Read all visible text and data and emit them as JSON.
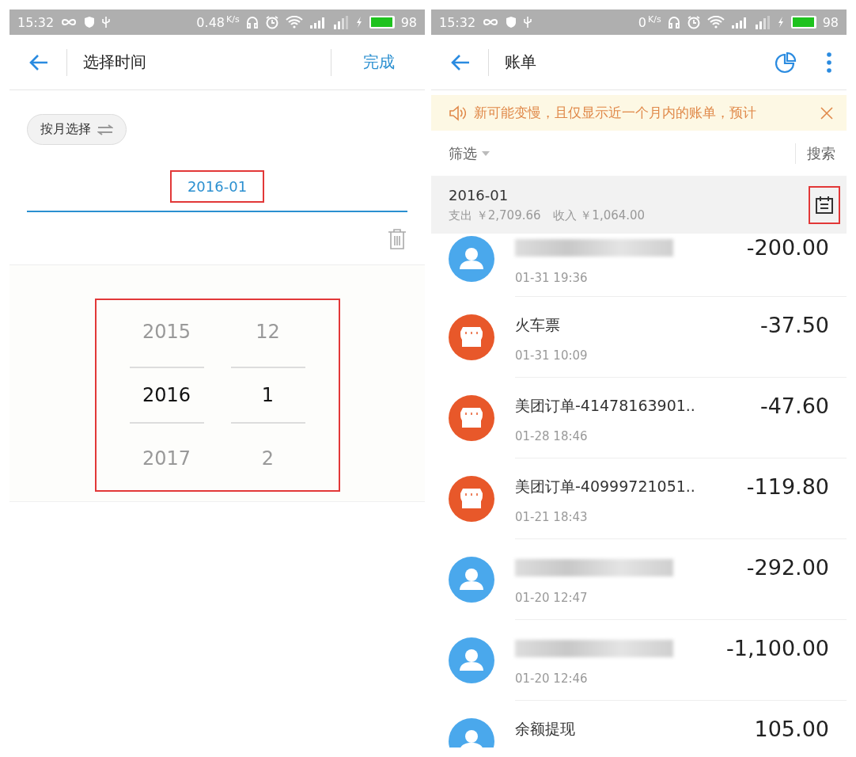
{
  "left_screen": {
    "status_bar": {
      "time": "15:32",
      "speed": "0.48",
      "speed_unit": "K/s",
      "battery": "98"
    },
    "header": {
      "title": "选择时间",
      "done": "完成"
    },
    "mode_toggle": {
      "label": "按月选择"
    },
    "date_field": {
      "value": "2016-01",
      "highlighted": true
    },
    "picker": {
      "highlighted": true,
      "columns": [
        {
          "items": [
            {
              "label": "2015",
              "selected": false
            },
            {
              "label": "2016",
              "selected": true
            },
            {
              "label": "2017",
              "selected": false
            }
          ]
        },
        {
          "items": [
            {
              "label": "12",
              "selected": false
            },
            {
              "label": "1",
              "selected": true
            },
            {
              "label": "2",
              "selected": false
            }
          ]
        }
      ]
    }
  },
  "right_screen": {
    "status_bar": {
      "time": "15:32",
      "speed": "0",
      "speed_unit": "K/s",
      "battery": "98"
    },
    "header": {
      "title": "账单"
    },
    "notice": {
      "text": "新可能变慢，且仅显示近一个月内的账单，预计"
    },
    "filter_bar": {
      "filter": "筛选",
      "search": "搜索"
    },
    "month": {
      "label": "2016-01",
      "summary": "支出 ￥2,709.66　收入 ￥1,064.00",
      "calendar_highlighted": true
    },
    "transactions": [
      {
        "kind": "person",
        "time": "01-31  19:36",
        "amount": "-200.00"
      },
      {
        "kind": "shop",
        "title": "火车票",
        "time": "01-31  10:09",
        "amount": "-37.50"
      },
      {
        "kind": "shop",
        "title": "美团订单-41478163901..",
        "time": "01-28  18:46",
        "amount": "-47.60"
      },
      {
        "kind": "shop",
        "title": "美团订单-40999721051..",
        "time": "01-21  18:43",
        "amount": "-119.80"
      },
      {
        "kind": "person",
        "time": "01-20  12:47",
        "amount": "-292.00"
      },
      {
        "kind": "person",
        "time": "01-20  12:46",
        "amount": "-1,100.00"
      },
      {
        "kind": "person",
        "title": "余额提现",
        "amount": "105.00"
      }
    ]
  }
}
